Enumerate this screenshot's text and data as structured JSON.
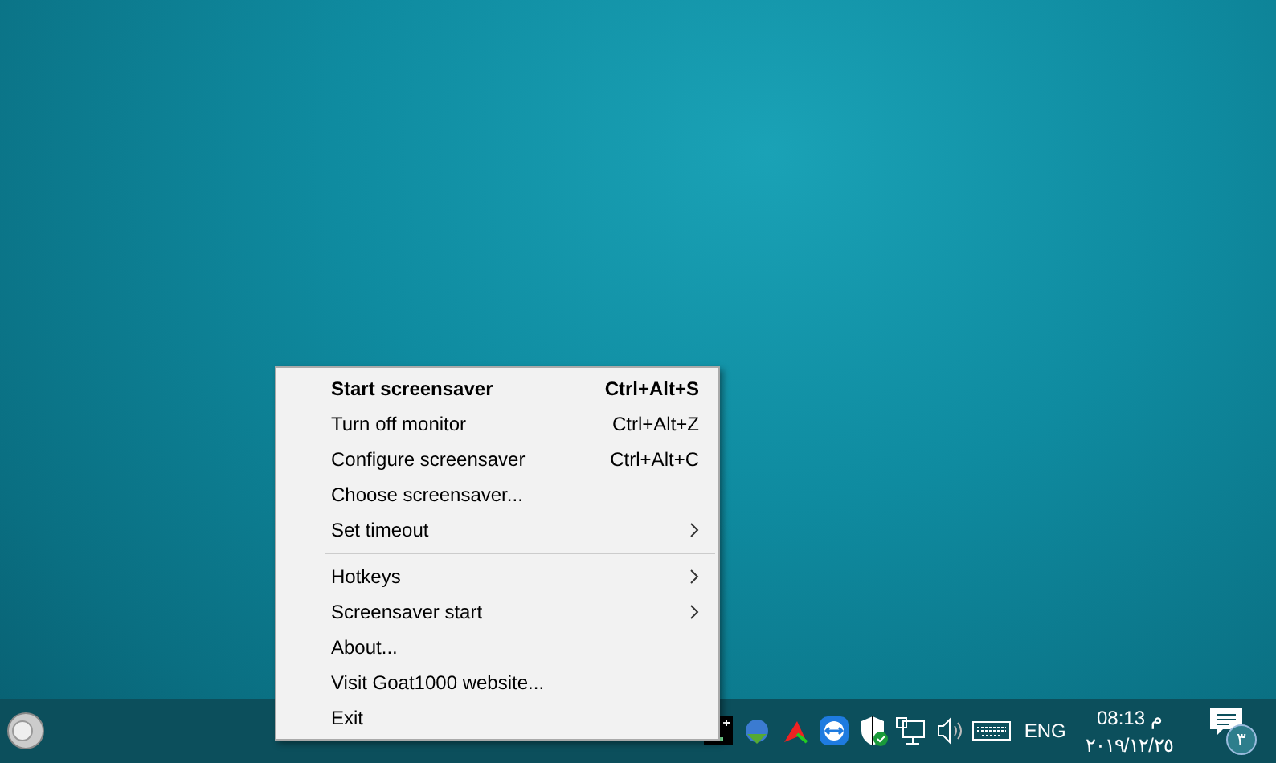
{
  "context_menu": {
    "items": [
      {
        "kind": "item",
        "label": "Start screensaver",
        "shortcut": "Ctrl+Alt+S",
        "default": true,
        "submenu": false
      },
      {
        "kind": "item",
        "label": "Turn off monitor",
        "shortcut": "Ctrl+Alt+Z",
        "default": false,
        "submenu": false
      },
      {
        "kind": "item",
        "label": "Configure screensaver",
        "shortcut": "Ctrl+Alt+C",
        "default": false,
        "submenu": false
      },
      {
        "kind": "item",
        "label": "Choose screensaver...",
        "default": false,
        "submenu": false
      },
      {
        "kind": "item",
        "label": "Set timeout",
        "default": false,
        "submenu": true
      },
      {
        "kind": "separator"
      },
      {
        "kind": "item",
        "label": "Hotkeys",
        "default": false,
        "submenu": true
      },
      {
        "kind": "item",
        "label": "Screensaver start",
        "default": false,
        "submenu": true
      },
      {
        "kind": "item",
        "label": "About...",
        "default": false,
        "submenu": false
      },
      {
        "kind": "item",
        "label": "Visit Goat1000 website...",
        "default": false,
        "submenu": false
      },
      {
        "kind": "item",
        "label": "Exit",
        "default": false,
        "submenu": false
      }
    ]
  },
  "taskbar": {
    "tray_icons": [
      {
        "kind": "terminal"
      },
      {
        "kind": "download"
      },
      {
        "kind": "arrow"
      },
      {
        "kind": "remote"
      },
      {
        "kind": "shield"
      },
      {
        "kind": "network"
      },
      {
        "kind": "volume"
      },
      {
        "kind": "keyboard"
      }
    ],
    "language": "ENG",
    "time": "08:13 م",
    "date": "٢٠١٩/١٢/٢٥",
    "notification_count": "٣"
  }
}
